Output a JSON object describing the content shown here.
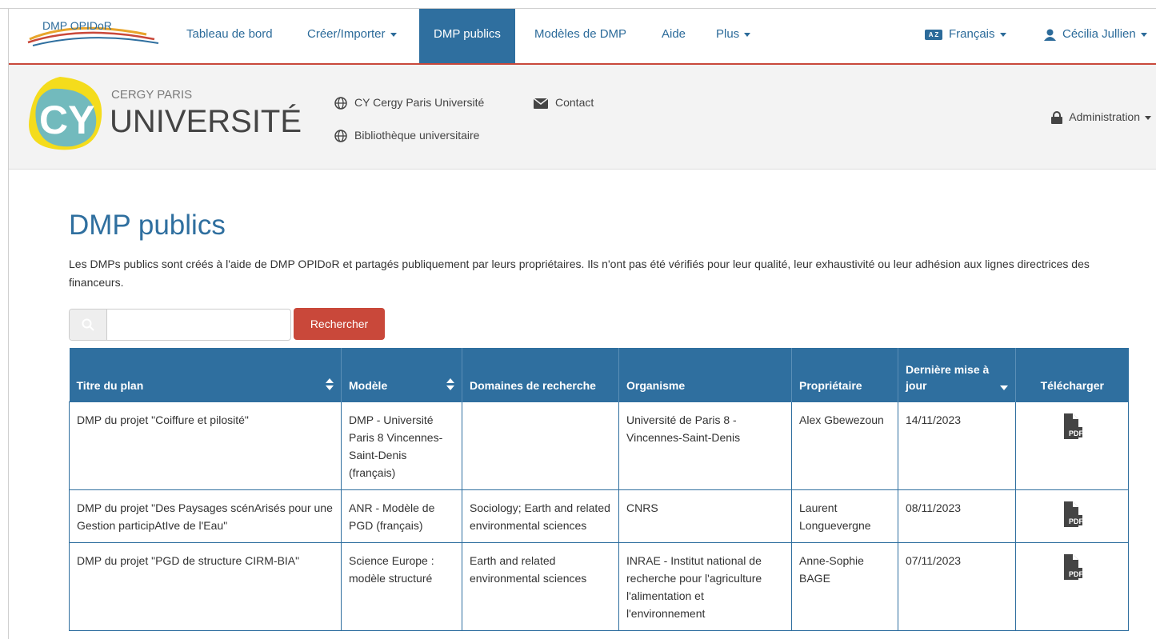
{
  "navbar": {
    "logo_text": "DMP OPIDoR",
    "items": [
      {
        "label": "Tableau de bord"
      },
      {
        "label": "Créer/Importer"
      },
      {
        "label": "DMP publics"
      },
      {
        "label": "Modèles de DMP"
      },
      {
        "label": "Aide"
      },
      {
        "label": "Plus"
      }
    ],
    "language": {
      "icon_text": "A Z",
      "label": "Français"
    },
    "user": {
      "label": "Cécilia Jullien"
    }
  },
  "org": {
    "logo_text_top": "CERGY PARIS",
    "logo_text_main": "UNIVERSITÉ",
    "logo_mark": "CY",
    "links": [
      {
        "label": "CY Cergy Paris Université",
        "icon": "globe-icon"
      },
      {
        "label": "Contact",
        "icon": "envelope-icon"
      },
      {
        "label": "Bibliothèque universitaire",
        "icon": "globe-icon"
      }
    ],
    "admin_label": "Administration"
  },
  "page": {
    "title": "DMP publics",
    "intro": "Les DMPs publics sont créés à l'aide de DMP OPIDoR et partagés publiquement par leurs propriétaires. Ils n'ont pas été vérifiés pour leur qualité, leur exhaustivité ou leur adhésion aux lignes directrices des financeurs.",
    "search": {
      "value": "",
      "placeholder": "",
      "button_label": "Rechercher"
    }
  },
  "table": {
    "headers": [
      "Titre du plan",
      "Modèle",
      "Domaines de recherche",
      "Organisme",
      "Propriétaire",
      "Dernière mise à jour",
      "Télécharger"
    ],
    "rows": [
      {
        "title": "DMP du projet \"Coiffure et pilosité\"",
        "template": "DMP - Université Paris 8 Vincennes-Saint-Denis (français)",
        "domains": "",
        "org": "Université de Paris 8 - Vincennes-Saint-Denis",
        "owner": "Alex Gbewezoun",
        "updated": "14/11/2023",
        "download": "PDF"
      },
      {
        "title": "DMP du projet \"Des Paysages scénArisés pour une Gestion participAtIve de l'Eau\"",
        "template": "ANR - Modèle de PGD (français)",
        "domains": "Sociology; Earth and related environmental sciences",
        "org": "CNRS",
        "owner": "Laurent Longuevergne",
        "updated": "08/11/2023",
        "download": "PDF"
      },
      {
        "title": "DMP du projet \"PGD de structure CIRM-BIA\"",
        "template": "Science Europe : modèle structuré",
        "domains": "Earth and related environmental sciences",
        "org": "INRAE - Institut national de recherche pour l'agriculture l'alimentation et l'environnement",
        "owner": "Anne-Sophie BAGE",
        "updated": "07/11/2023",
        "download": "PDF"
      }
    ]
  },
  "colors": {
    "primary": "#2f6f9f",
    "accent": "#c9483a",
    "link": "#2c6b9a"
  }
}
